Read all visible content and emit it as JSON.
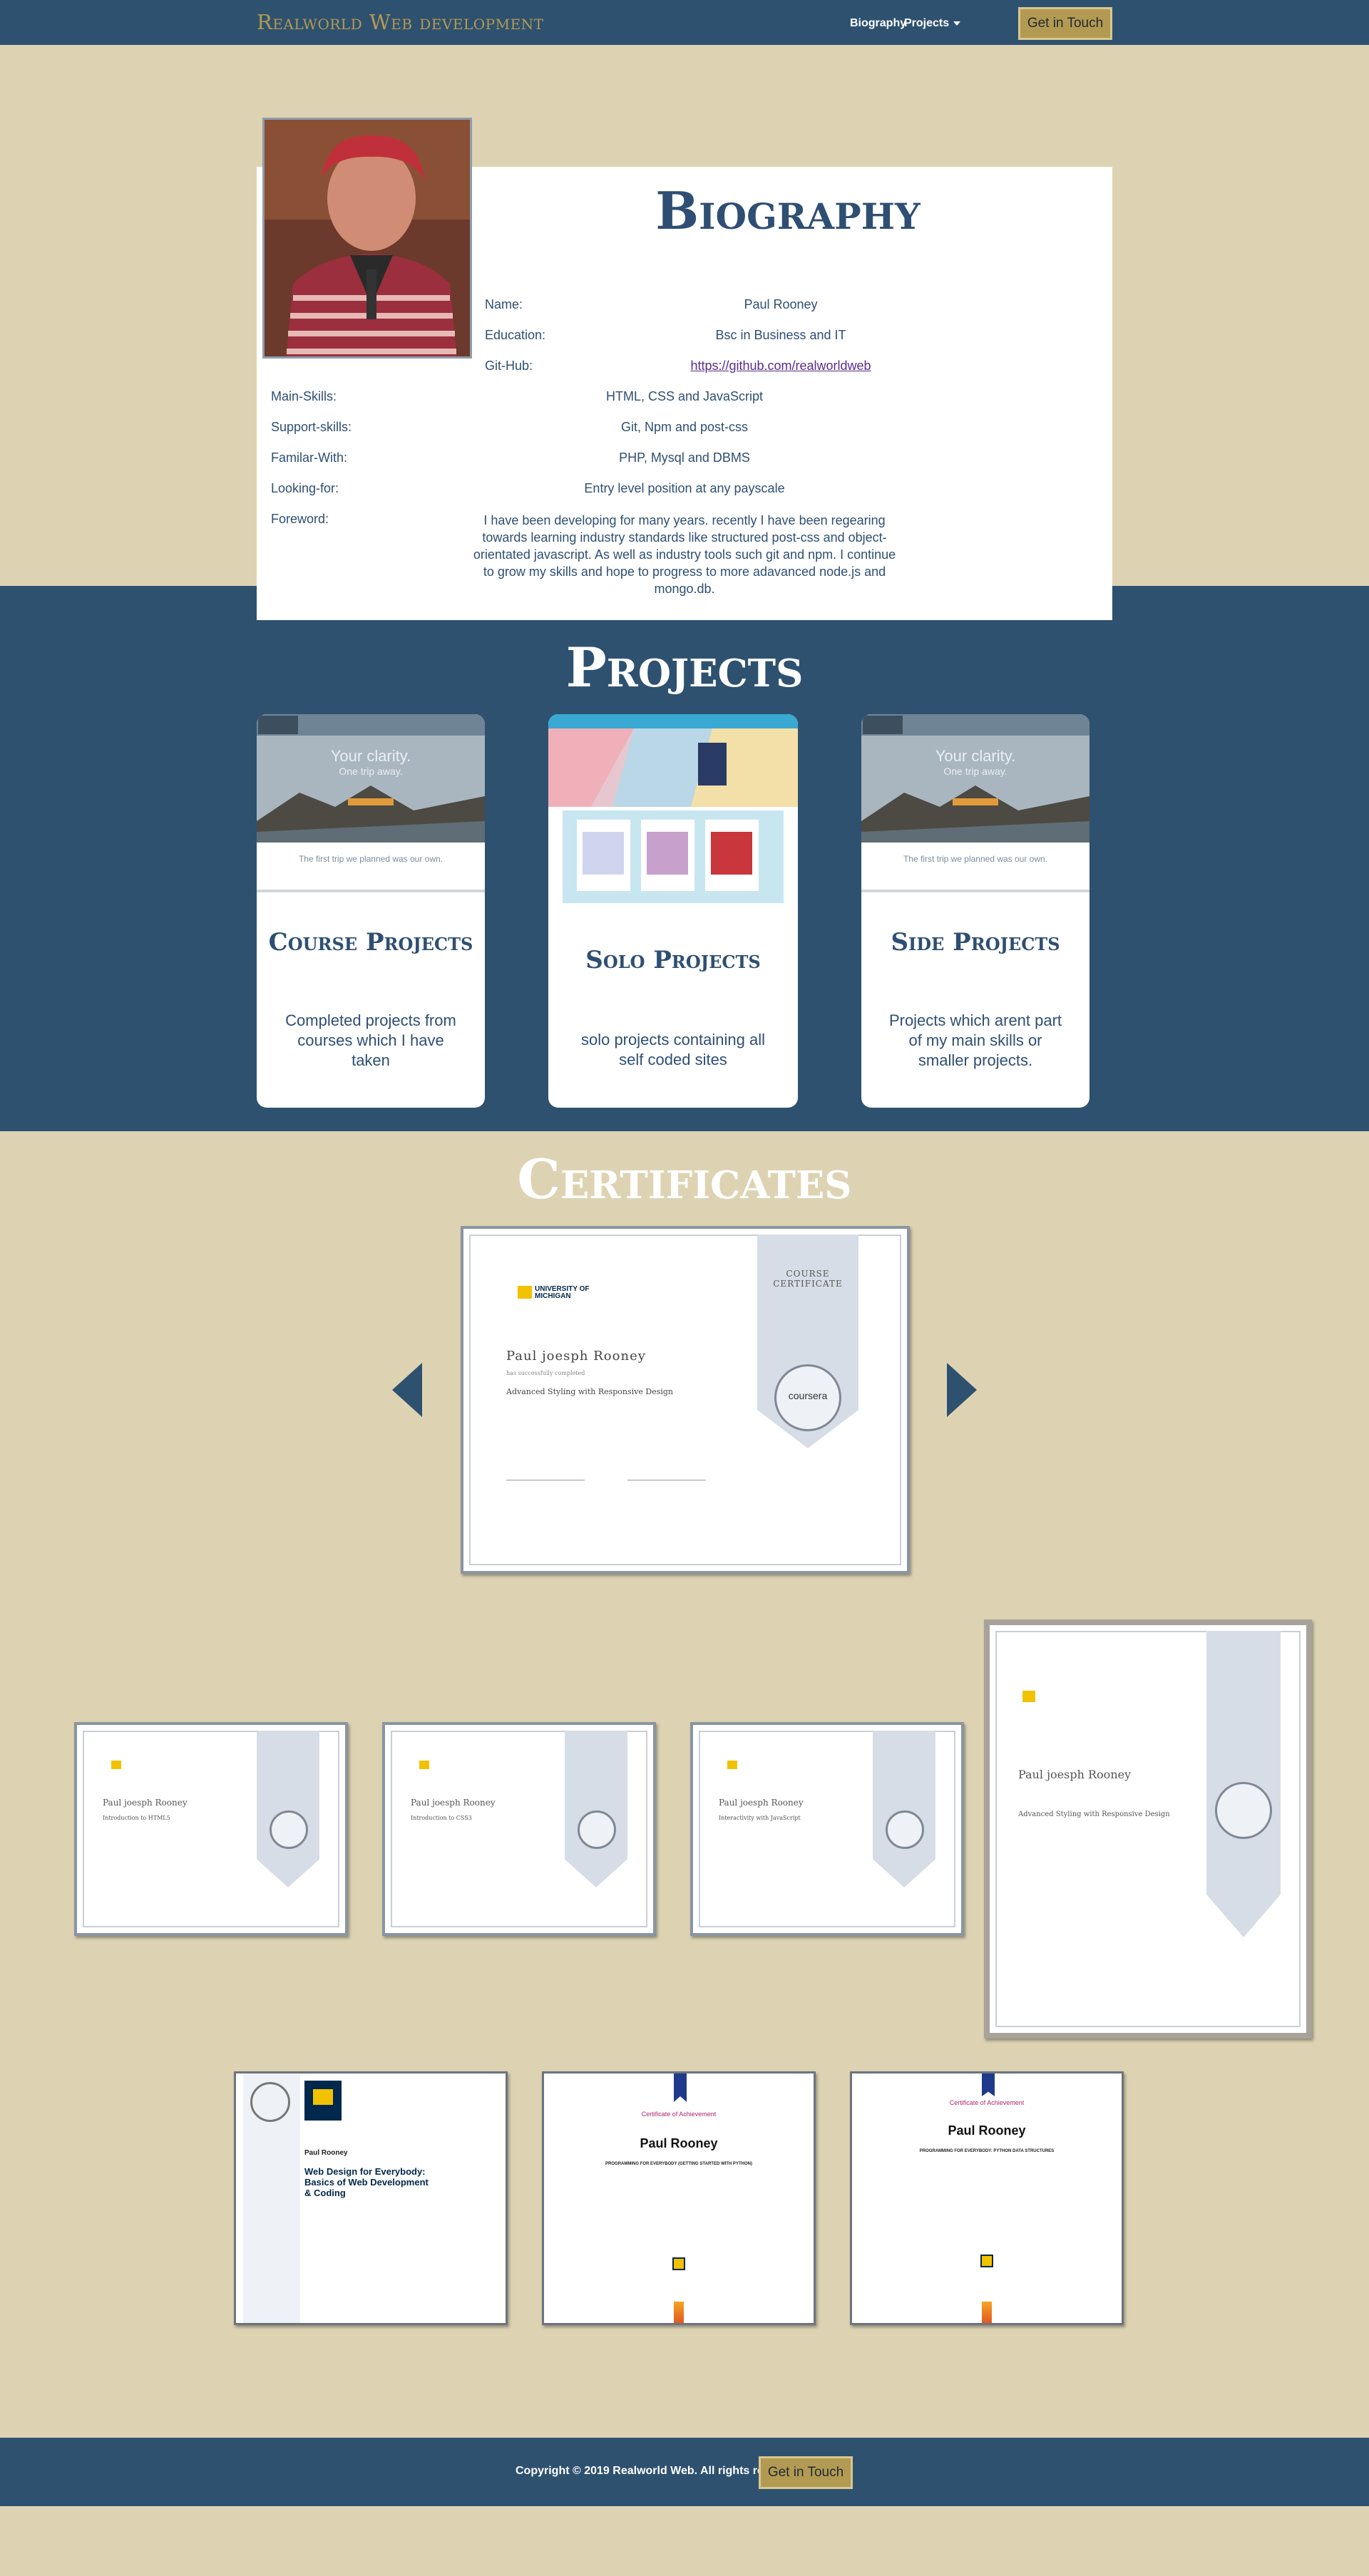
{
  "nav": {
    "brand": "Realworld Web development",
    "biography": "Biography",
    "projects": "Projects",
    "cta": "Get in Touch"
  },
  "bio": {
    "title": "Biography",
    "rows": [
      {
        "label": "Name:",
        "value": "Paul Rooney"
      },
      {
        "label": "Education:",
        "value": "Bsc in Business and IT"
      },
      {
        "label": "Git-Hub:",
        "value": "https://github.com/realworldweb"
      },
      {
        "label": "Main-Skills:",
        "value": "HTML, CSS and JavaScript"
      },
      {
        "label": "Support-skills:",
        "value": "Git, Npm and post-css"
      },
      {
        "label": "Familar-With:",
        "value": "PHP, Mysql and DBMS"
      },
      {
        "label": "Looking-for:",
        "value": "Entry level position at any payscale"
      },
      {
        "label": "Foreword:",
        "value": "I have been developing for many years. recently I have been regearing towards learning industry standards like structured post-css and object-orientated javascript. As well as industry tools such git and npm. I continue to grow my skills and hope to progress to more adavanced node.js and mongo.db."
      }
    ]
  },
  "projects": {
    "title": "Projects",
    "cards": [
      {
        "name": "Course Projects",
        "desc": "Completed projects from courses which I have taken",
        "thumb_title": "Your clarity.",
        "thumb_sub": "One trip away.",
        "thumb_tag": "The first trip we planned was our own."
      },
      {
        "name": "Solo Projects",
        "desc": "solo projects containing all self coded sites"
      },
      {
        "name": "Side Projects",
        "desc": "Projects which arent part of my main skills or smaller projects.",
        "thumb_title": "Your clarity.",
        "thumb_sub": "One trip away.",
        "thumb_tag": "The first trip we planned was our own."
      }
    ]
  },
  "certs": {
    "title": "Certificates",
    "main": {
      "university": "UNIVERSITY OF MICHIGAN",
      "course_cert": "COURSE CERTIFICATE",
      "name": "Paul joesph Rooney",
      "completed": "has successfully completed",
      "course": "Advanced Styling with Responsive Design",
      "seal": "coursera"
    },
    "thumbs": [
      {
        "course": "Introduction to HTML5",
        "name": "Paul joesph Rooney"
      },
      {
        "course": "Introduction to CSS3",
        "name": "Paul joesph Rooney"
      },
      {
        "course": "Interactivity with JavaScript",
        "name": "Paul joesph Rooney"
      },
      {
        "course": "Advanced Styling with Responsive Design",
        "name": "Paul joesph Rooney"
      }
    ],
    "bottom": [
      {
        "name": "Paul Rooney",
        "course": "Web Design for Everybody: Basics of Web Development & Coding"
      },
      {
        "name": "Paul Rooney",
        "heading": "Certificate of Achievement",
        "course": "PROGRAMMING FOR EVERYBODY (GETTING STARTED WITH PYTHON)"
      },
      {
        "name": "Paul Rooney",
        "heading": "Certificate of Achievement",
        "course": "PROGRAMMING FOR EVERYBODY: PYTHON DATA STRUCTURES"
      }
    ]
  },
  "footer": {
    "copyright": "Copyright © 2019 Realworld Web. All rights reserved.",
    "cta": "Get in Touch"
  },
  "colors": {
    "navy": "#2e5170",
    "sand": "#ddd3b3",
    "gold": "#b39a52",
    "text": "#2e4f73"
  }
}
